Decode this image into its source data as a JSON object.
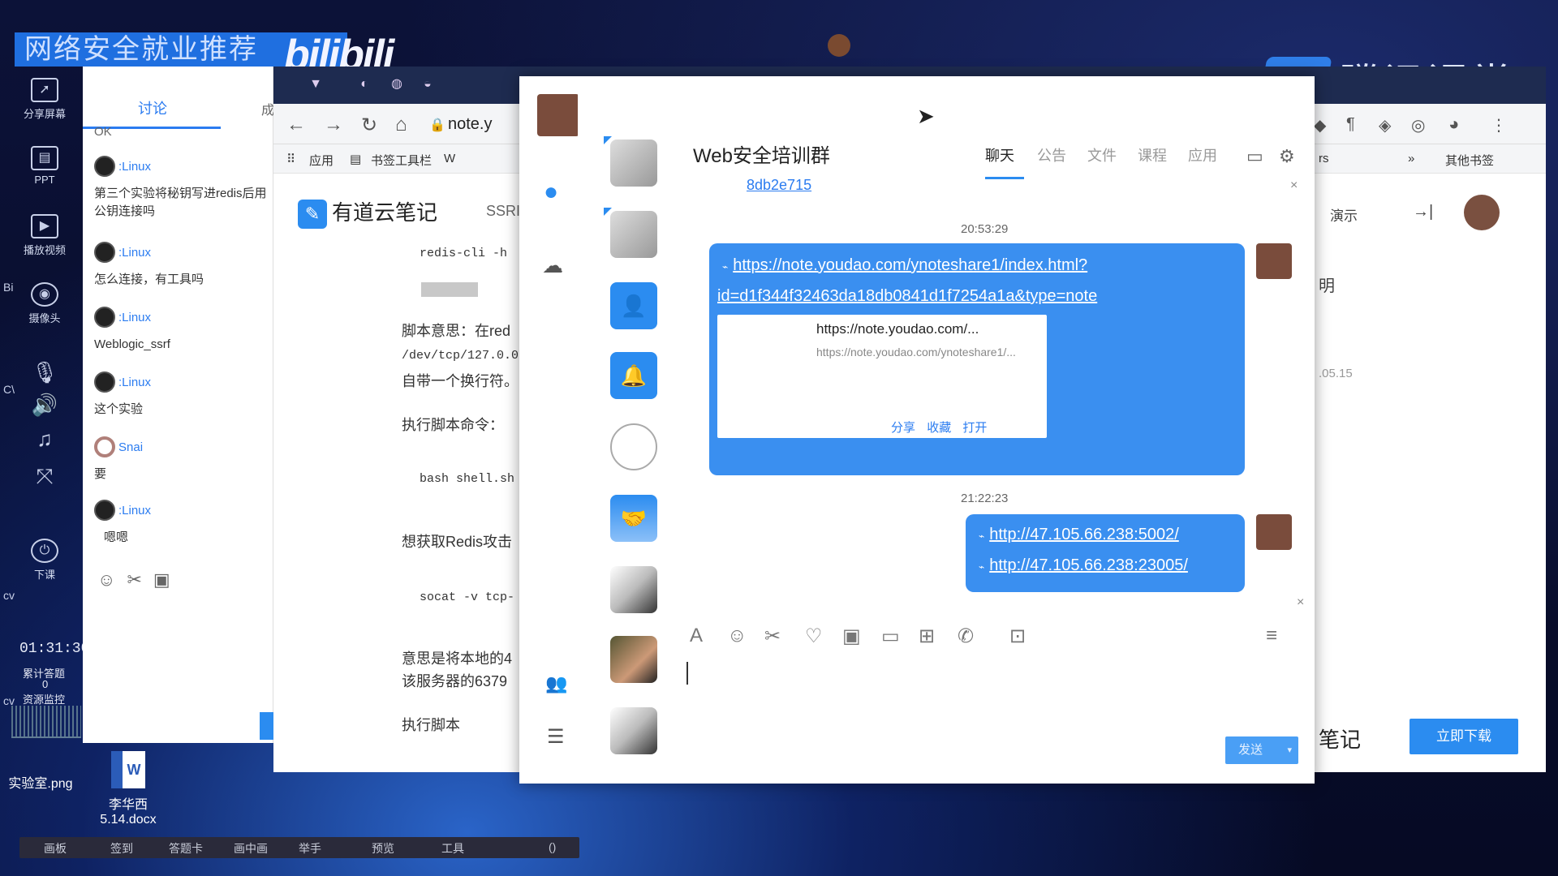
{
  "banner": {
    "text": "网络安全就业推荐",
    "bili_logo": "bilibili",
    "tencent_brand": "腾讯课堂"
  },
  "left_toolbar": {
    "items": [
      {
        "label": "分享屏幕",
        "icon": "share-screen-icon"
      },
      {
        "label": "PPT",
        "icon": "ppt-icon"
      },
      {
        "label": "播放视频",
        "icon": "play-video-icon"
      },
      {
        "label": "摄像头",
        "icon": "camera-icon"
      },
      {
        "label": "下课",
        "icon": "end-class-icon"
      }
    ],
    "timer": "01:31:30",
    "cumulative_label": "累计答题",
    "cumulative_value": "0",
    "resource_label": "资源监控",
    "edge_labels": [
      "Bi",
      "C\\",
      "cv",
      "cv"
    ]
  },
  "discussion": {
    "tab_active": "讨论",
    "tab_other": "成",
    "messages": [
      {
        "name": ":Linux",
        "text": "第三个实验将秘钥写进redis后用公钥连接吗",
        "avatar": "linux"
      },
      {
        "name": ":Linux",
        "text": "怎么连接，有工具吗",
        "avatar": "linux"
      },
      {
        "name": ":Linux",
        "text": "Weblogic_ssrf",
        "avatar": "linux"
      },
      {
        "name": ":Linux",
        "text": "这个实验",
        "avatar": "linux"
      },
      {
        "name": "Snai",
        "text": "要",
        "avatar": "snai"
      },
      {
        "name": ":Linux",
        "text": "嗯嗯",
        "avatar": "linux"
      }
    ],
    "cut_text": "OK"
  },
  "browser": {
    "url": "note.y",
    "bookmarks": [
      "应用",
      "书签工具栏",
      "W"
    ],
    "right_bookmarks": [
      "rs",
      "»",
      "其他书签"
    ],
    "note_brand": "有道云笔记",
    "ssr_label": "SSRI",
    "note_lines": [
      {
        "kind": "code",
        "text": "redis-cli -h"
      },
      {
        "kind": "text",
        "text": "脚本意思：在red"
      },
      {
        "kind": "code",
        "text": "/dev/tcp/127.0.0"
      },
      {
        "kind": "text",
        "text": "自带一个换行符。"
      },
      {
        "kind": "text",
        "text": "执行脚本命令："
      },
      {
        "kind": "code",
        "text": "bash shell.sh"
      },
      {
        "kind": "text",
        "text": "想获取Redis攻击"
      },
      {
        "kind": "code",
        "text": "socat -v tcp-"
      },
      {
        "kind": "text",
        "text": "意思是将本地的4"
      },
      {
        "kind": "text",
        "text": "该服务器的6379"
      },
      {
        "kind": "text",
        "text": "执行脚本"
      }
    ],
    "right_panel": {
      "demo_label": "演示",
      "char_ming": "明",
      "date_fragment": ".05.15",
      "bottom_brand": "笔记",
      "download_button": "立即下载"
    }
  },
  "qq": {
    "group_title": "Web安全培训群",
    "group_code": "8db2e715",
    "tabs": [
      "聊天",
      "公告",
      "文件",
      "课程",
      "应用"
    ],
    "messages": [
      {
        "time": "20:53:29",
        "link_line1": "https://note.youdao.com/ynoteshare1/index.html?",
        "link_line2": "id=d1f344f32463da18db0841d1f7254a1a&type=note",
        "card_title": "https://note.youdao.com/...",
        "card_desc": "https://note.youdao.com/ynoteshare1/...",
        "card_actions": [
          "分享",
          "收藏",
          "打开"
        ]
      },
      {
        "time": "21:22:23",
        "link_line1": "http://47.105.66.238:5002/",
        "link_line2": "http://47.105.66.238:23005/"
      }
    ],
    "send_button": "发送",
    "send_arrow": "▾"
  },
  "desktop": {
    "files": [
      {
        "name": "实验室.png"
      },
      {
        "name": "李华西\n5.14.docx",
        "line1": "李华西",
        "line2": "5.14.docx"
      }
    ],
    "taskbar": [
      "画板",
      "签到",
      "答题卡",
      "画中画",
      "举手",
      "预览",
      "工具",
      "()"
    ]
  }
}
